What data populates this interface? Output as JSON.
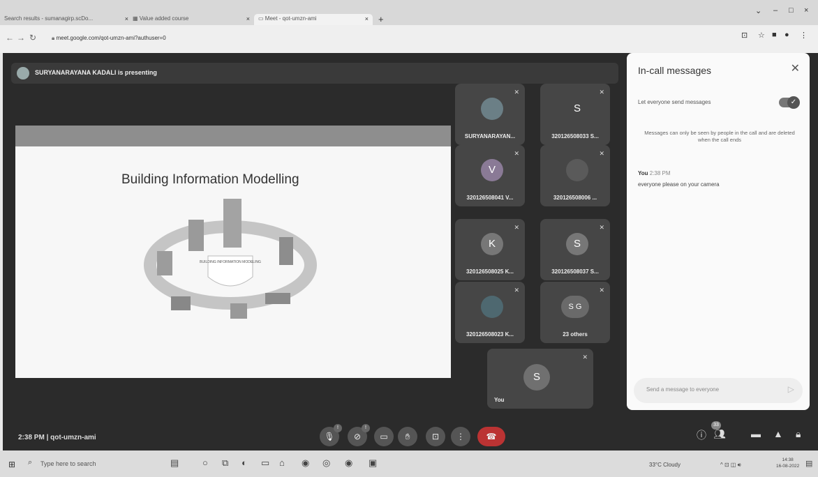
{
  "browser": {
    "tabs": [
      {
        "label": "Search results - sumanagirp.scDo...",
        "close": "×"
      },
      {
        "label": "Value added course",
        "close": "×"
      },
      {
        "label": "Meet - qot-umzn-ami",
        "close": "×"
      }
    ],
    "new_tab": "+",
    "url": "meet.google.com/qot-umzn-ami?authuser=0",
    "controls": {
      "minimize": "–",
      "restore": "□",
      "close": "×"
    }
  },
  "meet": {
    "presenter_banner": "SURYANARAYANA KADALI is presenting",
    "slide_title": "Building Information Modelling",
    "slide_center_text": "BUILDING INFORMATION MODELING",
    "tiles": [
      {
        "initial": "",
        "label": "SURYANARAYAN...",
        "color": "#6b7f86"
      },
      {
        "initial": "S",
        "label": "320126508033 S...",
        "color": "#464646"
      },
      {
        "initial": "V",
        "label": "320126508041 V...",
        "color": "#8a7a96"
      },
      {
        "initial": "",
        "label": "320126508006 ...",
        "color": "#5a5a5a"
      },
      {
        "initial": "K",
        "label": "320126508025 K...",
        "color": "#777777"
      },
      {
        "initial": "S",
        "label": "320126508037 S...",
        "color": "#777777"
      },
      {
        "initial": "",
        "label": "320126508023 K...",
        "color": "#4e6870"
      },
      {
        "initial": "S G",
        "label": "23 others",
        "color": "#6a6a6a"
      }
    ],
    "self_tile": {
      "initial": "S",
      "label": "You"
    },
    "meeting_info": "2:38 PM  |  qot-umzn-ami",
    "participant_count": "33"
  },
  "chat": {
    "heading": "In-call messages",
    "toggle_label": "Let everyone send messages",
    "notice": "Messages can only be seen by people in the call and are deleted when the call ends",
    "message": {
      "sender": "You",
      "time": "2:38 PM",
      "text": "everyone please on your camera"
    },
    "input_placeholder": "Send a message to everyone"
  },
  "taskbar": {
    "search_placeholder": "Type here to search",
    "weather": "33°C  Cloudy",
    "time": "14:38",
    "date": "16-08-2022"
  }
}
